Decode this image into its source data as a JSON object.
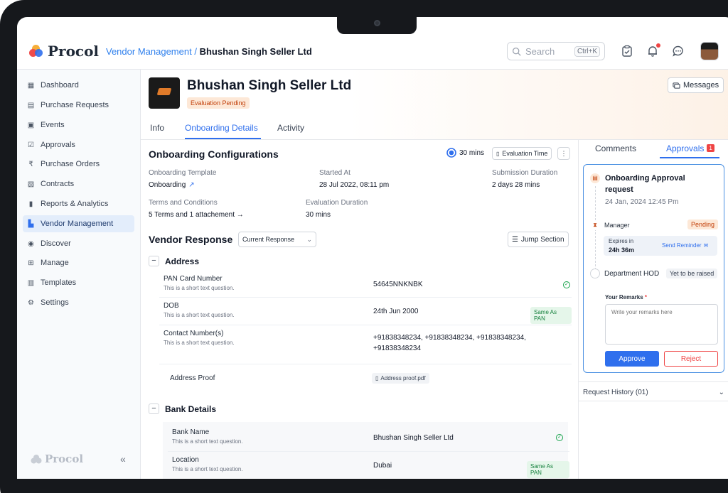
{
  "app": {
    "name": "Procol"
  },
  "breadcrumb": {
    "parent": "Vendor Management",
    "separator": "/",
    "current": "Bhushan Singh Seller Ltd"
  },
  "search": {
    "placeholder": "Search",
    "shortcut": "Ctrl+K"
  },
  "sidebar": {
    "items": [
      {
        "label": "Dashboard",
        "icon": "dashboard-icon"
      },
      {
        "label": "Purchase Requests",
        "icon": "document-icon"
      },
      {
        "label": "Events",
        "icon": "calendar-icon"
      },
      {
        "label": "Approvals",
        "icon": "clipboard-check-icon"
      },
      {
        "label": "Purchase Orders",
        "icon": "rupee-icon"
      },
      {
        "label": "Contracts",
        "icon": "contract-icon"
      },
      {
        "label": "Reports & Analytics",
        "icon": "bar-chart-icon"
      },
      {
        "label": "Vendor Management",
        "icon": "vendor-icon",
        "active": true
      },
      {
        "label": "Discover",
        "icon": "eye-icon"
      },
      {
        "label": "Manage",
        "icon": "grid-icon"
      },
      {
        "label": "Templates",
        "icon": "template-icon"
      },
      {
        "label": "Settings",
        "icon": "gear-icon"
      }
    ],
    "footer_logo": "Procol"
  },
  "vendor": {
    "name": "Bhushan Singh Seller Ltd",
    "status": "Evaluation Pending"
  },
  "header": {
    "messages_label": "Messages"
  },
  "tabs": [
    {
      "label": "Info"
    },
    {
      "label": "Onboarding Details",
      "active": true
    },
    {
      "label": "Activity"
    }
  ],
  "onboarding": {
    "title": "Onboarding Configurations",
    "time": "30 mins",
    "evaluation_time_label": "Evaluation Time",
    "fields": {
      "template_label": "Onboarding Template",
      "template_value": "Onboarding",
      "started_label": "Started At",
      "started_value": "28 Jul 2022, 08:11 pm",
      "submission_label": "Submission Duration",
      "submission_value": "2 days 28 mins",
      "terms_label": "Terms and Conditions",
      "terms_value": "5 Terms and 1 attachement →",
      "eval_label": "Evaluation Duration",
      "eval_value": "30 mins"
    }
  },
  "vendor_response": {
    "title": "Vendor Response",
    "dropdown_value": "Current Response",
    "jump_label": "Jump Section",
    "address": {
      "title": "Address",
      "rows": [
        {
          "question": "PAN Card Number",
          "hint": "This is a short text question.",
          "answer": "54645NNKNBK"
        },
        {
          "question": "DOB",
          "hint": "This is a short text question.",
          "answer": "24th Jun 2000",
          "tag": "Same As PAN"
        },
        {
          "question": "Contact Number(s)",
          "hint": "This is a short text question.",
          "answer": "+91838348234, +91838348234, +91838348234, +91838348234"
        },
        {
          "question": "Address Proof",
          "file": "Address proof.pdf"
        }
      ]
    },
    "bank": {
      "title": "Bank Details",
      "rows": [
        {
          "question": "Bank Name",
          "hint": "This is a short text question.",
          "answer": "Bhushan Singh Seller Ltd"
        },
        {
          "question": "Location",
          "hint": "This is a short text question.",
          "answer": "Dubai",
          "tag": "Same As PAN"
        }
      ]
    }
  },
  "right_panel": {
    "tabs": [
      {
        "label": "Comments"
      },
      {
        "label": "Approvals",
        "badge": "1",
        "active": true
      }
    ],
    "approval": {
      "title": "Onboarding Approval request",
      "date": "24 Jan, 2024 12:45 Pm",
      "manager_label": "Manager",
      "manager_status": "Pending",
      "expires_label": "Expires in",
      "expires_value": "24h 36m",
      "reminder_label": "Send Reminder",
      "hod_label": "Department HOD",
      "hod_status": "Yet to be raised",
      "remarks_label": "Your Remarks",
      "remarks_required": "*",
      "remarks_placeholder": "Write your remarks here",
      "approve_label": "Approve",
      "reject_label": "Reject"
    },
    "history_label": "Request History (01)"
  },
  "colors": {
    "accent": "#2f6fed",
    "pending": "#c2410c",
    "success": "#15803d",
    "danger": "#ef4444"
  }
}
